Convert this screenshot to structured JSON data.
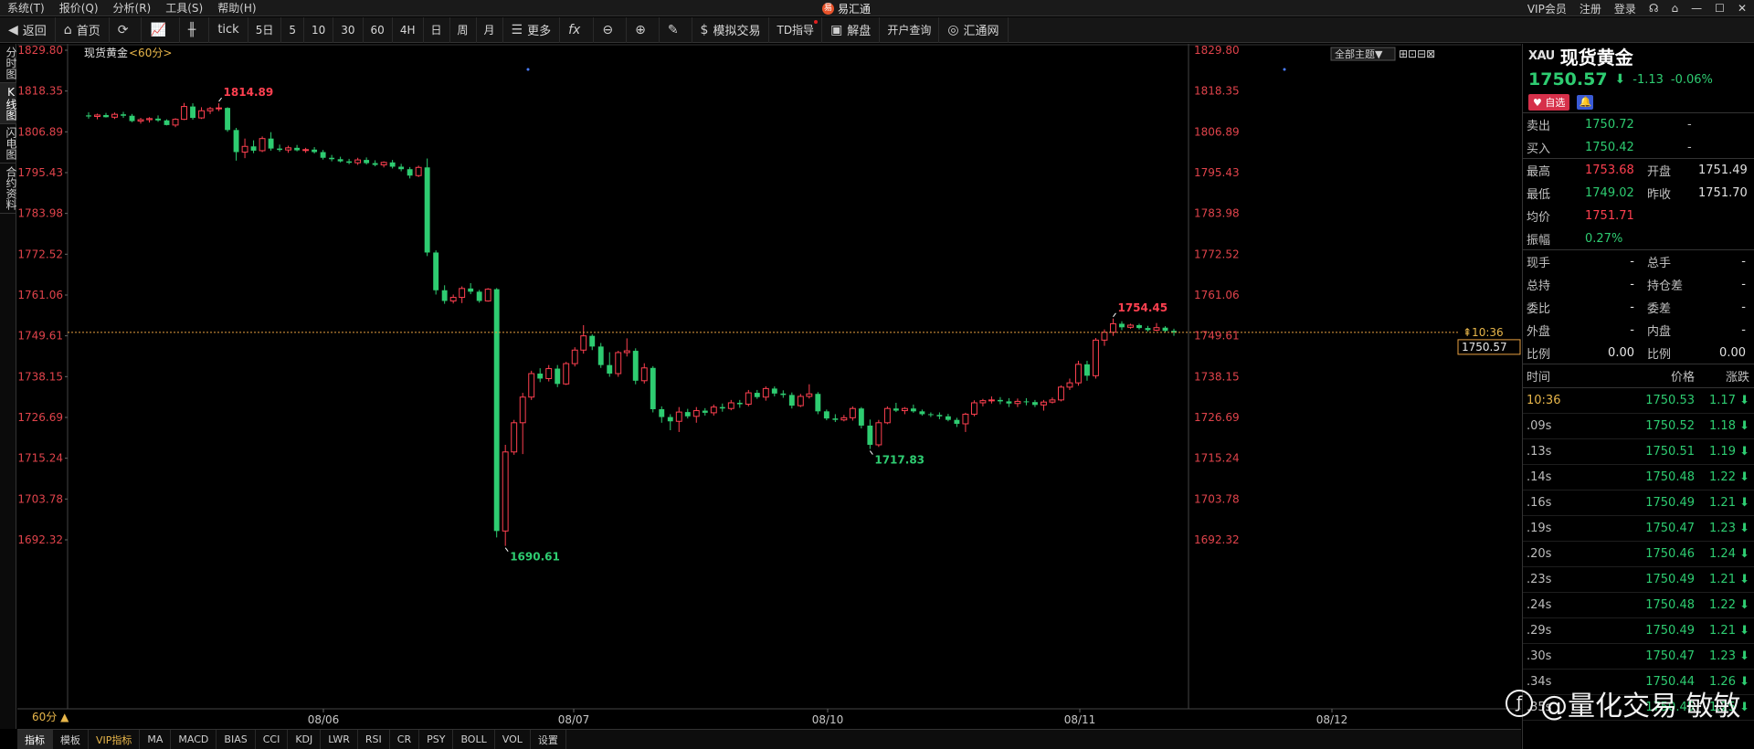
{
  "menubar": {
    "items": [
      "系统(T)",
      "报价(Q)",
      "分析(R)",
      "工具(S)",
      "帮助(H)"
    ],
    "app_title": "易汇通",
    "right": [
      "VIP会员",
      "注册",
      "登录"
    ]
  },
  "toolbar": {
    "back": "返回",
    "home": "首页",
    "tick": "tick",
    "periods": [
      "5日",
      "5",
      "10",
      "30",
      "60",
      "4H",
      "日",
      "周",
      "月"
    ],
    "more": "更多",
    "sim_trade": "模拟交易",
    "td_guide": "TD指导",
    "analysis": "解盘",
    "account": "开户查询",
    "hui_tong": "汇通网"
  },
  "left_tabs": [
    "分时图",
    "K线图",
    "闪电图",
    "合约资料"
  ],
  "chart": {
    "title": "现货黄金",
    "period_label": "<60分>",
    "theme_button": "全部主题▼",
    "current_price_label": "1750.57",
    "current_time_label": "10:36",
    "period_selector": "60分 ▲"
  },
  "chart_data": {
    "type": "candlestick",
    "title": "现货黄金",
    "y_ticks": [
      1829.8,
      1818.35,
      1806.89,
      1795.43,
      1783.98,
      1772.52,
      1761.06,
      1749.61,
      1738.15,
      1726.69,
      1715.24,
      1703.78,
      1692.32
    ],
    "ylim": [
      1690.0,
      1831.0
    ],
    "x_labels": [
      "08/06",
      "08/07",
      "08/10",
      "08/11",
      "08/12"
    ],
    "annotations": [
      {
        "text": "1814.89",
        "kind": "high"
      },
      {
        "text": "1690.61",
        "kind": "low"
      },
      {
        "text": "1717.83",
        "kind": "low"
      },
      {
        "text": "1754.45",
        "kind": "high"
      }
    ],
    "current_price": 1750.57,
    "ohlc": [
      [
        1811.5,
        1812.4,
        1810.6,
        1811.2
      ],
      [
        1811.2,
        1812.0,
        1810.4,
        1811.6
      ],
      [
        1811.6,
        1812.2,
        1810.9,
        1811.0
      ],
      [
        1811.0,
        1812.3,
        1810.5,
        1811.8
      ],
      [
        1811.8,
        1812.5,
        1810.8,
        1811.4
      ],
      [
        1811.4,
        1811.9,
        1809.6,
        1809.9
      ],
      [
        1809.9,
        1810.8,
        1809.2,
        1810.3
      ],
      [
        1810.3,
        1811.0,
        1809.5,
        1810.6
      ],
      [
        1810.6,
        1811.5,
        1809.7,
        1810.1
      ],
      [
        1810.1,
        1810.4,
        1808.7,
        1808.8
      ],
      [
        1808.8,
        1810.7,
        1808.2,
        1810.4
      ],
      [
        1810.4,
        1815.0,
        1810.2,
        1814.0
      ],
      [
        1814.0,
        1814.9,
        1810.3,
        1810.8
      ],
      [
        1810.8,
        1813.8,
        1810.5,
        1812.8
      ],
      [
        1812.8,
        1813.9,
        1811.9,
        1813.4
      ],
      [
        1813.4,
        1814.89,
        1812.7,
        1813.6
      ],
      [
        1813.6,
        1813.8,
        1806.9,
        1807.4
      ],
      [
        1807.4,
        1808.0,
        1798.8,
        1801.2
      ],
      [
        1801.2,
        1805.0,
        1799.5,
        1802.8
      ],
      [
        1802.8,
        1804.5,
        1800.9,
        1801.6
      ],
      [
        1801.6,
        1805.6,
        1801.2,
        1805.0
      ],
      [
        1805.0,
        1806.8,
        1801.6,
        1802.2
      ],
      [
        1802.2,
        1803.3,
        1801.3,
        1801.8
      ],
      [
        1801.8,
        1803.0,
        1801.0,
        1802.4
      ],
      [
        1802.4,
        1803.2,
        1801.4,
        1801.7
      ],
      [
        1801.7,
        1802.4,
        1801.0,
        1801.9
      ],
      [
        1801.9,
        1802.6,
        1800.8,
        1801.2
      ],
      [
        1801.2,
        1801.8,
        1799.1,
        1799.6
      ],
      [
        1799.6,
        1800.4,
        1798.6,
        1799.2
      ],
      [
        1799.2,
        1799.9,
        1798.3,
        1798.6
      ],
      [
        1798.6,
        1799.3,
        1797.8,
        1798.2
      ],
      [
        1798.2,
        1799.6,
        1797.6,
        1799.0
      ],
      [
        1799.0,
        1799.7,
        1797.7,
        1798.1
      ],
      [
        1798.1,
        1798.9,
        1797.2,
        1797.6
      ],
      [
        1797.6,
        1798.6,
        1796.9,
        1798.3
      ],
      [
        1798.3,
        1799.0,
        1796.6,
        1797.1
      ],
      [
        1797.1,
        1797.9,
        1795.8,
        1796.4
      ],
      [
        1796.4,
        1797.0,
        1793.8,
        1794.6
      ],
      [
        1794.6,
        1797.4,
        1794.2,
        1796.9
      ],
      [
        1796.9,
        1799.4,
        1772.0,
        1773.0
      ],
      [
        1773.0,
        1773.6,
        1761.2,
        1762.4
      ],
      [
        1762.4,
        1763.8,
        1758.6,
        1759.4
      ],
      [
        1759.4,
        1761.2,
        1758.7,
        1760.4
      ],
      [
        1760.4,
        1763.5,
        1758.8,
        1762.9
      ],
      [
        1762.9,
        1764.4,
        1761.3,
        1762.0
      ],
      [
        1762.0,
        1762.5,
        1758.9,
        1759.4
      ],
      [
        1759.4,
        1763.0,
        1759.2,
        1762.7
      ],
      [
        1762.7,
        1763.0,
        1693.0,
        1694.8
      ],
      [
        1694.8,
        1719.0,
        1690.61,
        1717.0
      ],
      [
        1717.0,
        1726.0,
        1716.2,
        1725.2
      ],
      [
        1725.2,
        1733.6,
        1716.4,
        1732.4
      ],
      [
        1732.4,
        1739.8,
        1731.6,
        1739.0
      ],
      [
        1739.0,
        1740.5,
        1736.6,
        1737.6
      ],
      [
        1737.6,
        1741.4,
        1736.8,
        1740.4
      ],
      [
        1740.4,
        1741.4,
        1735.2,
        1736.1
      ],
      [
        1736.1,
        1742.3,
        1735.8,
        1741.8
      ],
      [
        1741.8,
        1746.4,
        1741.0,
        1745.6
      ],
      [
        1745.6,
        1752.6,
        1744.6,
        1749.6
      ],
      [
        1749.6,
        1750.0,
        1745.6,
        1746.6
      ],
      [
        1746.6,
        1747.6,
        1740.6,
        1741.4
      ],
      [
        1741.4,
        1745.0,
        1738.1,
        1739.0
      ],
      [
        1739.0,
        1745.4,
        1738.1,
        1744.9
      ],
      [
        1744.9,
        1748.9,
        1743.8,
        1745.4
      ],
      [
        1745.4,
        1746.1,
        1736.0,
        1737.0
      ],
      [
        1737.0,
        1741.9,
        1736.2,
        1740.6
      ],
      [
        1740.6,
        1741.1,
        1728.1,
        1729.0
      ],
      [
        1729.0,
        1729.8,
        1725.2,
        1726.8
      ],
      [
        1726.8,
        1727.6,
        1723.1,
        1725.6
      ],
      [
        1725.6,
        1729.6,
        1722.6,
        1728.2
      ],
      [
        1728.2,
        1729.1,
        1726.4,
        1727.0
      ],
      [
        1727.0,
        1729.6,
        1725.2,
        1728.6
      ],
      [
        1728.6,
        1729.3,
        1727.2,
        1728.0
      ],
      [
        1728.0,
        1730.3,
        1727.2,
        1729.6
      ],
      [
        1729.6,
        1730.6,
        1728.3,
        1729.2
      ],
      [
        1729.2,
        1731.6,
        1728.7,
        1730.8
      ],
      [
        1730.8,
        1731.6,
        1729.4,
        1730.4
      ],
      [
        1730.4,
        1734.4,
        1729.8,
        1733.6
      ],
      [
        1733.6,
        1734.4,
        1731.9,
        1732.4
      ],
      [
        1732.4,
        1735.4,
        1731.4,
        1734.8
      ],
      [
        1734.8,
        1735.4,
        1732.6,
        1733.4
      ],
      [
        1733.4,
        1734.3,
        1732.2,
        1733.0
      ],
      [
        1733.0,
        1733.7,
        1729.2,
        1730.0
      ],
      [
        1730.0,
        1733.3,
        1729.6,
        1732.6
      ],
      [
        1732.6,
        1736.0,
        1732.0,
        1733.3
      ],
      [
        1733.3,
        1733.8,
        1727.6,
        1728.4
      ],
      [
        1728.4,
        1728.9,
        1725.9,
        1726.4
      ],
      [
        1726.4,
        1727.6,
        1725.4,
        1726.0
      ],
      [
        1726.0,
        1727.4,
        1725.6,
        1726.6
      ],
      [
        1726.6,
        1729.8,
        1725.8,
        1729.2
      ],
      [
        1729.2,
        1729.6,
        1723.6,
        1724.4
      ],
      [
        1724.4,
        1726.1,
        1717.83,
        1719.0
      ],
      [
        1719.0,
        1726.0,
        1718.4,
        1725.2
      ],
      [
        1725.2,
        1729.8,
        1724.8,
        1729.2
      ],
      [
        1729.2,
        1730.8,
        1728.2,
        1728.6
      ],
      [
        1728.6,
        1729.6,
        1727.6,
        1729.2
      ],
      [
        1729.2,
        1730.3,
        1728.0,
        1728.4
      ],
      [
        1728.4,
        1728.9,
        1727.2,
        1727.6
      ],
      [
        1727.6,
        1728.1,
        1726.8,
        1727.4
      ],
      [
        1727.4,
        1728.1,
        1726.2,
        1727.0
      ],
      [
        1727.0,
        1727.7,
        1725.6,
        1726.0
      ],
      [
        1726.0,
        1726.6,
        1724.0,
        1724.9
      ],
      [
        1724.9,
        1728.0,
        1722.6,
        1727.6
      ],
      [
        1727.6,
        1731.5,
        1727.0,
        1730.8
      ],
      [
        1730.8,
        1731.9,
        1729.8,
        1731.4
      ],
      [
        1731.4,
        1732.6,
        1730.6,
        1731.6
      ],
      [
        1731.6,
        1732.4,
        1730.4,
        1731.2
      ],
      [
        1731.2,
        1732.1,
        1729.6,
        1730.6
      ],
      [
        1730.6,
        1732.0,
        1729.6,
        1731.2
      ],
      [
        1731.2,
        1732.1,
        1730.1,
        1731.0
      ],
      [
        1731.0,
        1731.6,
        1729.6,
        1730.2
      ],
      [
        1730.2,
        1731.6,
        1728.6,
        1731.0
      ],
      [
        1731.0,
        1732.3,
        1730.6,
        1731.6
      ],
      [
        1731.6,
        1735.7,
        1731.2,
        1735.2
      ],
      [
        1735.2,
        1737.6,
        1734.4,
        1736.4
      ],
      [
        1736.4,
        1742.6,
        1735.6,
        1741.6
      ],
      [
        1741.6,
        1742.6,
        1737.0,
        1738.4
      ],
      [
        1738.4,
        1749.0,
        1737.6,
        1748.4
      ],
      [
        1748.4,
        1751.4,
        1746.8,
        1750.6
      ],
      [
        1750.6,
        1754.45,
        1749.6,
        1753.0
      ],
      [
        1753.0,
        1753.7,
        1751.2,
        1752.0
      ],
      [
        1752.0,
        1753.0,
        1751.6,
        1752.6
      ],
      [
        1752.6,
        1753.0,
        1751.4,
        1751.8
      ],
      [
        1751.8,
        1752.4,
        1750.8,
        1751.2
      ],
      [
        1751.2,
        1753.2,
        1750.9,
        1751.9
      ],
      [
        1751.9,
        1752.3,
        1750.6,
        1751.0
      ],
      [
        1751.0,
        1751.6,
        1749.6,
        1750.57
      ]
    ]
  },
  "quote": {
    "code": "XAU",
    "name": "现货黄金",
    "price": "1750.57",
    "change": "-1.13",
    "change_pct": "-0.06%",
    "fav_label": "自选",
    "sell_label": "卖出",
    "sell_value": "1750.72",
    "sell_extra": "-",
    "buy_label": "买入",
    "buy_value": "1750.42",
    "buy_extra": "-",
    "high_label": "最高",
    "high_value": "1753.68",
    "open_label": "开盘",
    "open_value": "1751.49",
    "low_label": "最低",
    "low_value": "1749.02",
    "prev_label": "昨收",
    "prev_value": "1751.70",
    "avg_label": "均价",
    "avg_value": "1751.71",
    "amp_label": "振幅",
    "amp_value": "0.27%",
    "rows2": [
      {
        "l1": "现手",
        "v1": "-",
        "l2": "总手",
        "v2": "-"
      },
      {
        "l1": "总持",
        "v1": "-",
        "l2": "持仓差",
        "v2": "-"
      },
      {
        "l1": "委比",
        "v1": "-",
        "l2": "委差",
        "v2": "-"
      },
      {
        "l1": "外盘",
        "v1": "-",
        "l2": "内盘",
        "v2": "-"
      },
      {
        "l1": "比例",
        "v1": "0.00",
        "l2": "比例",
        "v2": "0.00"
      }
    ],
    "tick_headers": [
      "时间",
      "价格",
      "涨跌"
    ],
    "ticks": [
      {
        "time": "10:36",
        "price": "1750.53",
        "chg": "1.17"
      },
      {
        "time": ".09s",
        "price": "1750.52",
        "chg": "1.18"
      },
      {
        "time": ".13s",
        "price": "1750.51",
        "chg": "1.19"
      },
      {
        "time": ".14s",
        "price": "1750.48",
        "chg": "1.22"
      },
      {
        "time": ".16s",
        "price": "1750.49",
        "chg": "1.21"
      },
      {
        "time": ".19s",
        "price": "1750.47",
        "chg": "1.23"
      },
      {
        "time": ".20s",
        "price": "1750.46",
        "chg": "1.24"
      },
      {
        "time": ".23s",
        "price": "1750.49",
        "chg": "1.21"
      },
      {
        "time": ".24s",
        "price": "1750.48",
        "chg": "1.22"
      },
      {
        "time": ".29s",
        "price": "1750.49",
        "chg": "1.21"
      },
      {
        "time": ".30s",
        "price": "1750.47",
        "chg": "1.23"
      },
      {
        "time": ".34s",
        "price": "1750.44",
        "chg": "1.26"
      },
      {
        "time": ".35s",
        "price": "1750.45",
        "chg": "1.25"
      }
    ]
  },
  "indicators": [
    "指标",
    "模板",
    "VIP指标",
    "MA",
    "MACD",
    "BIAS",
    "CCI",
    "KDJ",
    "LWR",
    "RSI",
    "CR",
    "PSY",
    "BOLL",
    "VOL",
    "设置"
  ],
  "watermark": "@量化交易 敏敏",
  "colors": {
    "up": "#ff4050",
    "down": "#2ecc71",
    "bg": "#000000",
    "axis_text": "#e0434b",
    "current_line": "#e8a040"
  }
}
